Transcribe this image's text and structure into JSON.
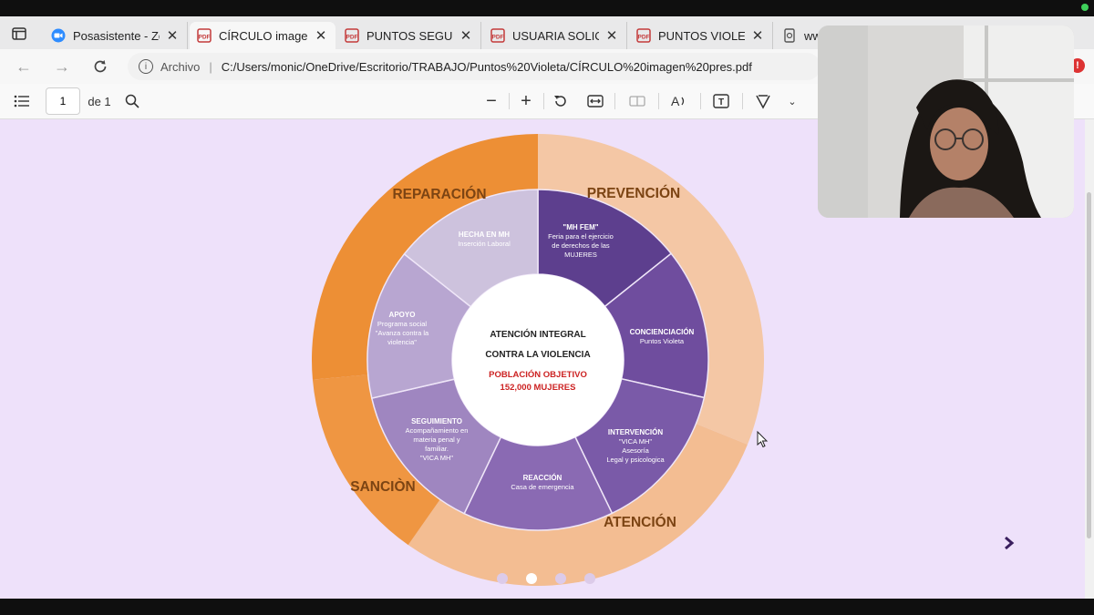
{
  "browser": {
    "tabs": [
      {
        "label": "Posasistente - Zoom",
        "icon": "zoom-icon",
        "active": false
      },
      {
        "label": "CÍRCULO imagen pres",
        "icon": "pdf-icon",
        "active": true
      },
      {
        "label": "PUNTOS SEGUROS",
        "icon": "pdf-icon",
        "active": false
      },
      {
        "label": "USUARIA SOLICITA",
        "icon": "pdf-icon",
        "active": false
      },
      {
        "label": "PUNTOS VIOLETA CDMX",
        "icon": "pdf-icon",
        "active": false
      },
      {
        "label": "www",
        "icon": "web-icon",
        "active": false
      }
    ],
    "address": {
      "scheme": "Archivo",
      "url": "C:/Users/monic/OneDrive/Escritorio/TRABAJO/Puntos%20Violeta/CÍRCULO%20imagen%20pres.pdf"
    },
    "notification_badge": "!"
  },
  "pdf_toolbar": {
    "page_current": "1",
    "page_of": "de 1"
  },
  "diagram": {
    "outer": {
      "prevencion": "PREVENCIÓN",
      "reparacion": "REPARACIÓN",
      "sancion": "SANCIÒN",
      "atencion": "ATENCIÓN"
    },
    "segments": {
      "mhfem": {
        "title": "\"MH FEM\"",
        "lines": [
          "Feria para el ejercicio",
          "de derechos de las",
          "MUJERES"
        ]
      },
      "concienciacion": {
        "title": "CONCIENCIACIÓN",
        "lines": [
          "Puntos Violeta"
        ]
      },
      "intervencion": {
        "title": "INTERVENCIÓN",
        "lines": [
          "\"VICA MH\"",
          "Asesoría",
          "Legal y psicologica"
        ]
      },
      "reaccion": {
        "title": "REACCIÓN",
        "lines": [
          "Casa de emergencia"
        ]
      },
      "seguimiento": {
        "title": "SEGUIMIENTO",
        "lines": [
          "Acompañamiento en",
          "materia penal y",
          "familiar.",
          "\"VICA MH\""
        ]
      },
      "apoyo": {
        "title": "APOYO",
        "lines": [
          "Programa social",
          "\"Avanza contra la",
          "violencia\""
        ]
      },
      "hecha": {
        "title": "HECHA EN MH",
        "lines": [
          "Inserción Laboral"
        ]
      }
    },
    "center": {
      "line1": "ATENCIÓN INTEGRAL",
      "line2": "CONTRA LA VIOLENCIA",
      "target1": "POBLACIÓN OBJETIVO",
      "target2": "152,000 MUJERES"
    },
    "carousel": {
      "slide_count": 4,
      "active_index": 1
    }
  },
  "colors": {
    "accent_purple": "#5d3f8e",
    "orange": "#ef9642",
    "peach": "#f4c7a5",
    "page_bg": "#eee1fa",
    "target_red": "#cc2222"
  }
}
